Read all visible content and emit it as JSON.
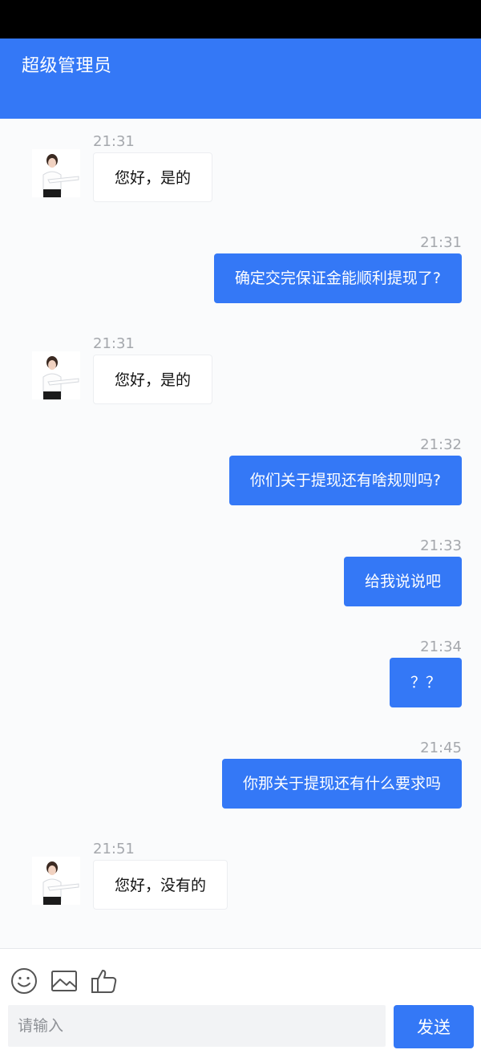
{
  "header": {
    "title": "超级管理员"
  },
  "colors": {
    "accent": "#3478f6",
    "status_bar": "#000000",
    "background": "#fafbfc"
  },
  "messages": [
    {
      "side": "left",
      "time": "21:31",
      "text": "您好，是的"
    },
    {
      "side": "right",
      "time": "21:31",
      "text": "确定交完保证金能顺利提现了?"
    },
    {
      "side": "left",
      "time": "21:31",
      "text": "您好，是的"
    },
    {
      "side": "right",
      "time": "21:32",
      "text": "你们关于提现还有啥规则吗?"
    },
    {
      "side": "right",
      "time": "21:33",
      "text": "给我说说吧"
    },
    {
      "side": "right",
      "time": "21:34",
      "text": "？？"
    },
    {
      "side": "right",
      "time": "21:45",
      "text": "你那关于提现还有什么要求吗"
    },
    {
      "side": "left",
      "time": "21:51",
      "text": "您好，没有的"
    }
  ],
  "composer": {
    "icons": [
      "emoji-icon",
      "image-icon",
      "thumbs-up-icon"
    ],
    "input_placeholder": "请输入",
    "input_value": "",
    "send_label": "发送"
  }
}
